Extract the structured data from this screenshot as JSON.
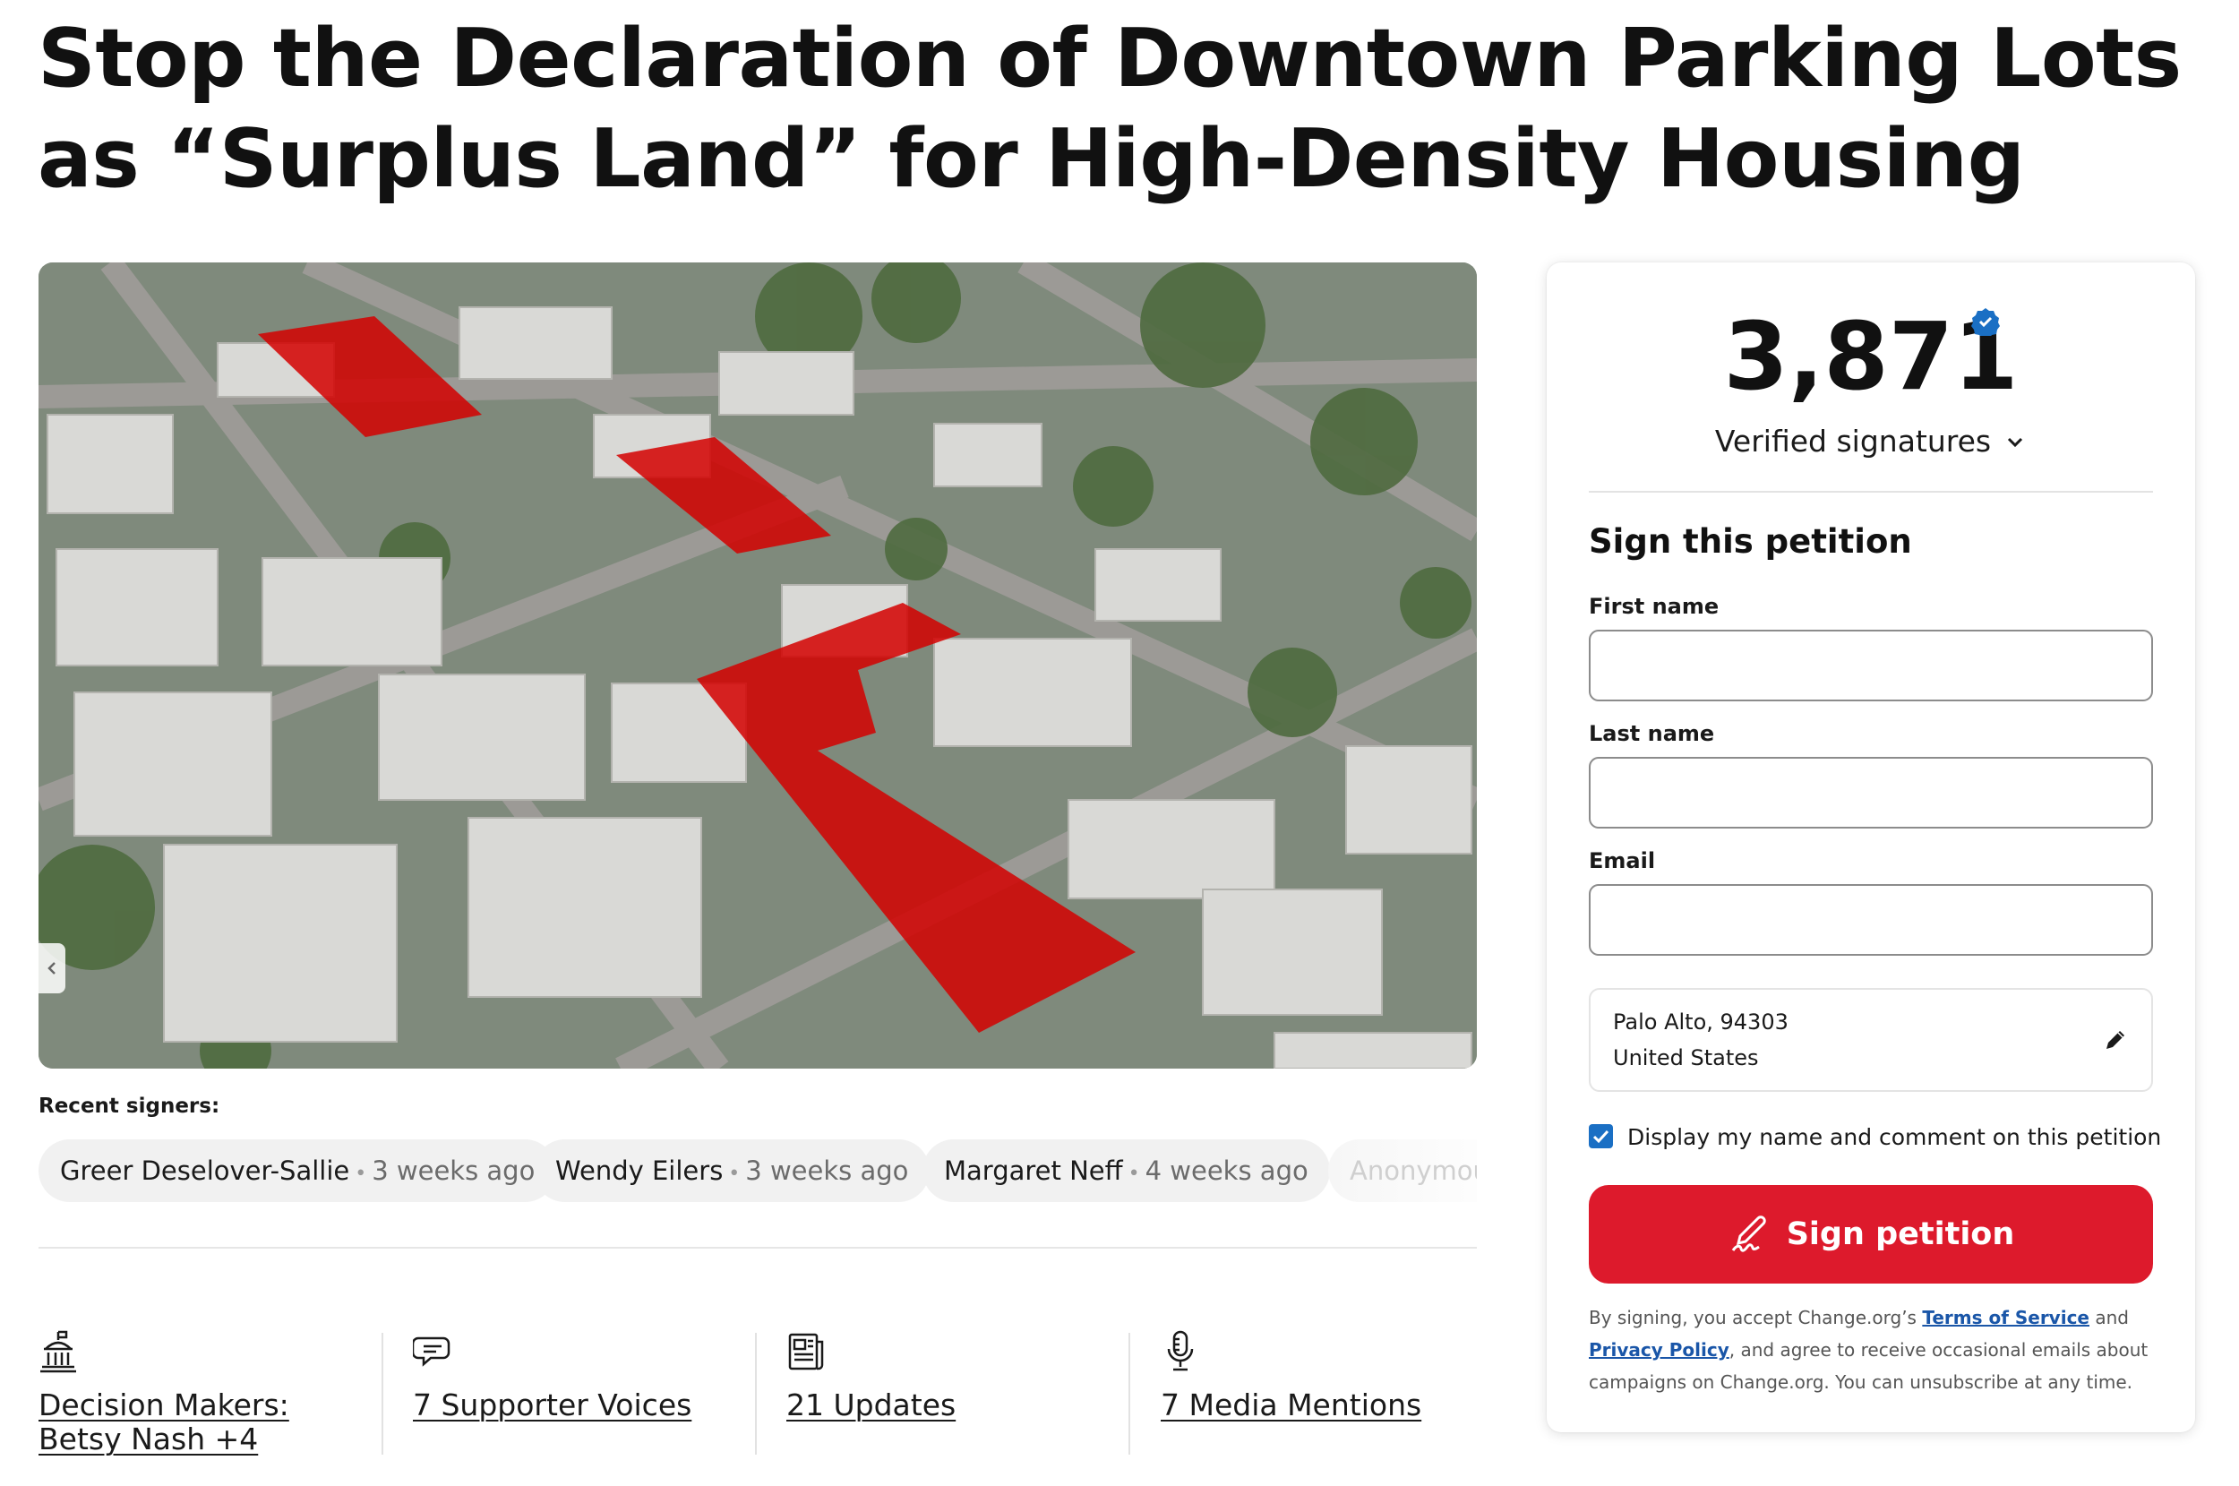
{
  "petition": {
    "title": "Stop the Declaration of Downtown Parking Lots as “Surplus Land” for High-Density Housing"
  },
  "recent_signers": {
    "label": "Recent signers:",
    "items": [
      {
        "name": "Greer Deselover-Sallie",
        "time": "3 weeks ago"
      },
      {
        "name": "Wendy Eilers",
        "time": "3 weeks ago"
      },
      {
        "name": "Margaret Neff",
        "time": "4 weeks ago"
      },
      {
        "name": "Anonymou",
        "time": ""
      }
    ]
  },
  "stats": [
    {
      "icon": "capitol-building-icon",
      "label": "Decision Makers: Betsy Nash +4"
    },
    {
      "icon": "speech-bubbles-icon",
      "label": "7 Supporter Voices"
    },
    {
      "icon": "newspaper-icon",
      "label": "21 Updates"
    },
    {
      "icon": "microphone-icon",
      "label": "7 Media Mentions"
    }
  ],
  "signatures": {
    "count": "3,871",
    "label": "Verified signatures",
    "badge_icon": "verified-badge-icon",
    "chevron_icon": "chevron-down-icon"
  },
  "form": {
    "heading": "Sign this petition",
    "first_name_label": "First name",
    "first_name_value": "",
    "last_name_label": "Last name",
    "last_name_value": "",
    "email_label": "Email",
    "email_value": "",
    "location_line1": "Palo Alto, 94303",
    "location_line2": "United States",
    "display_name_label": "Display my name and comment on this petition",
    "display_name_checked": true,
    "submit_label": "Sign petition"
  },
  "legal": {
    "prefix": "By signing, you accept Change.org’s ",
    "terms_link": "Terms of Service",
    "and": " and ",
    "privacy_link": "Privacy Policy",
    "suffix": ", and agree to receive occasional emails about campaigns on Change.org. You can unsubscribe at any time."
  },
  "colors": {
    "accent_red": "#dd1a2c",
    "link_blue": "#1a56a8",
    "check_blue": "#1a6fc4",
    "highlight_red": "#d40000"
  }
}
